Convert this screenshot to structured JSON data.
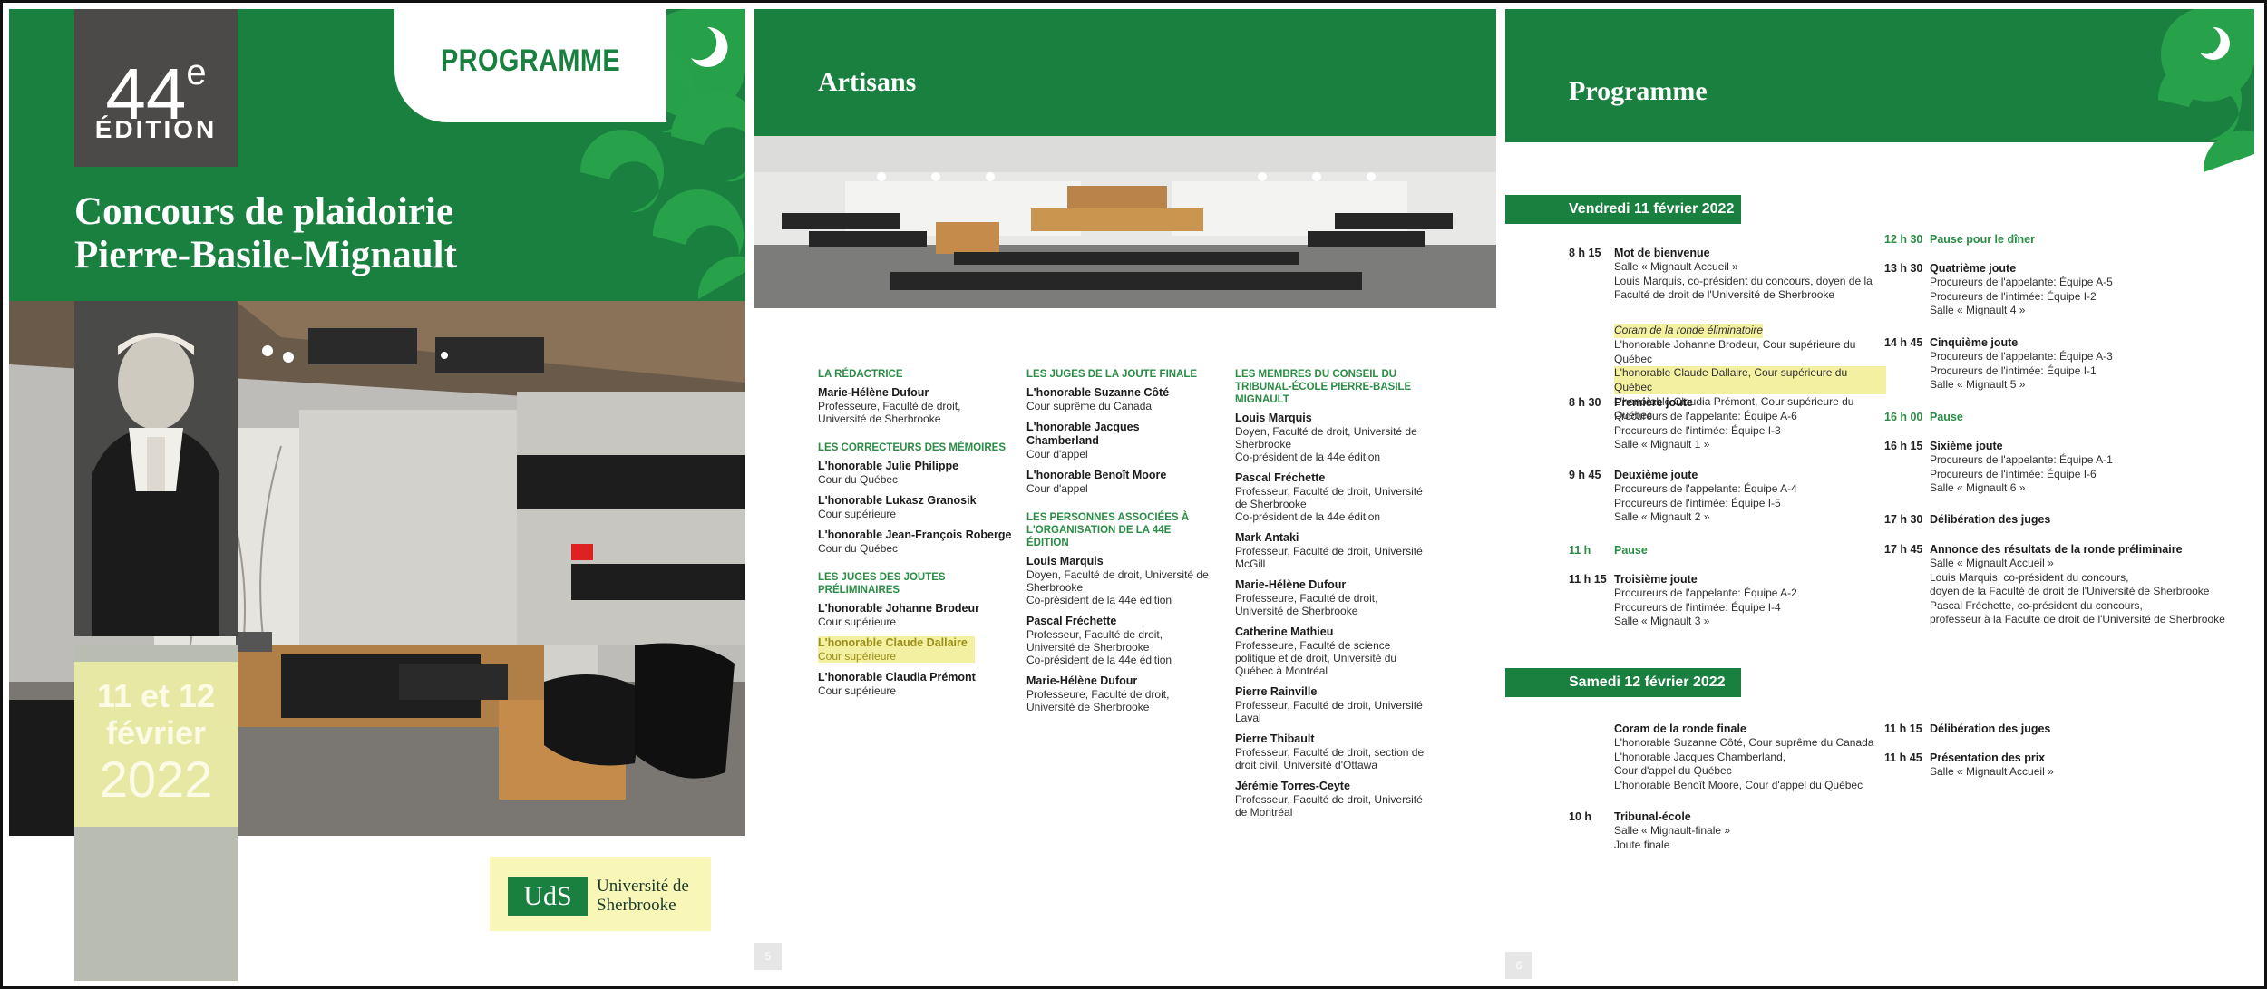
{
  "page1": {
    "edition_number": "44",
    "edition_suffix": "e",
    "edition_word": "ÉDITION",
    "tab_label": "PROGRAMME",
    "title_line1": "Concours de plaidoirie",
    "title_line2": "Pierre-Basile-Mignault",
    "date_line1": "11 et 12",
    "date_line2": "février",
    "date_line3": "2022",
    "logo_mark": "UdS",
    "logo_name_line1": "Université de",
    "logo_name_line2": "Sherbrooke",
    "colors": {
      "brand_green": "#1a8040",
      "highlight": "#f4f0a2"
    }
  },
  "page2": {
    "title": "Artisans",
    "page_number": "5",
    "col1": [
      {
        "heading": "LA RÉDACTRICE",
        "entries": [
          {
            "name": "Marie-Hélène Dufour",
            "roles": [
              "Professeure, Faculté de droit,",
              "Université de Sherbrooke"
            ]
          }
        ]
      },
      {
        "heading": "LES CORRECTEURS DES MÉMOIRES",
        "entries": [
          {
            "name": "L'honorable Julie Philippe",
            "roles": [
              "Cour du Québec"
            ]
          },
          {
            "name": "L'honorable Lukasz Granosik",
            "roles": [
              "Cour supérieure"
            ]
          },
          {
            "name": "L'honorable Jean-François Roberge",
            "roles": [
              "Cour du Québec"
            ]
          }
        ]
      },
      {
        "heading": "LES JUGES DES JOUTES PRÉLIMINAIRES",
        "entries": [
          {
            "name": "L'honorable Johanne Brodeur",
            "roles": [
              "Cour supérieure"
            ]
          },
          {
            "name": "L'honorable Claude Dallaire",
            "roles": [
              "Cour supérieure"
            ],
            "highlight": true
          },
          {
            "name": "L'honorable Claudia Prémont",
            "roles": [
              "Cour supérieure"
            ]
          }
        ]
      }
    ],
    "col2": [
      {
        "heading": "LES JUGES DE LA JOUTE FINALE",
        "entries": [
          {
            "name": "L'honorable Suzanne Côté",
            "roles": [
              "Cour suprême du Canada"
            ]
          },
          {
            "name": "L'honorable Jacques Chamberland",
            "roles": [
              "Cour d'appel"
            ]
          },
          {
            "name": "L'honorable Benoît Moore",
            "roles": [
              "Cour d'appel"
            ]
          }
        ]
      },
      {
        "heading": "LES PERSONNES ASSOCIÉES À L'ORGANISATION DE LA 44e ÉDITION",
        "entries": [
          {
            "name": "Louis Marquis",
            "roles": [
              "Doyen, Faculté de droit, Université de Sherbrooke",
              "Co-président de la 44e édition"
            ]
          },
          {
            "name": "Pascal Fréchette",
            "roles": [
              "Professeur, Faculté de droit, Université de Sherbrooke",
              "Co-président de la 44e édition"
            ]
          },
          {
            "name": "Marie-Hélène Dufour",
            "roles": [
              "Professeure, Faculté de droit, Université de Sherbrooke"
            ]
          }
        ]
      }
    ],
    "col3": [
      {
        "heading": "LES MEMBRES DU CONSEIL DU TRIBUNAL-ÉCOLE PIERRE-BASILE MIGNAULT",
        "entries": [
          {
            "name": "Louis Marquis",
            "roles": [
              "Doyen, Faculté de droit, Université de Sherbrooke",
              "Co-président de la 44e édition"
            ]
          },
          {
            "name": "Pascal Fréchette",
            "roles": [
              "Professeur, Faculté de droit, Université de Sherbrooke",
              "Co-président de la 44e édition"
            ]
          },
          {
            "name": "Mark Antaki",
            "roles": [
              "Professeur, Faculté de droit, Université McGill"
            ]
          },
          {
            "name": "Marie-Hélène Dufour",
            "roles": [
              "Professeure, Faculté de droit, Université de Sherbrooke"
            ]
          },
          {
            "name": "Catherine Mathieu",
            "roles": [
              "Professeure, Faculté de science politique et de droit, Université du Québec à Montréal"
            ]
          },
          {
            "name": "Pierre Rainville",
            "roles": [
              "Professeur, Faculté de droit, Université Laval"
            ]
          },
          {
            "name": "Pierre Thibault",
            "roles": [
              "Professeur, Faculté de droit, section de droit civil, Université d'Ottawa"
            ]
          },
          {
            "name": "Jérémie Torres-Ceyte",
            "roles": [
              "Professeur, Faculté de droit, Université de Montréal"
            ]
          }
        ]
      }
    ]
  },
  "page3": {
    "title": "Programme",
    "page_number": "6",
    "day1": "Vendredi 11 février 2022",
    "day2": "Samedi 12 février 2022",
    "day1_left": [
      {
        "time": "8 h 15",
        "title": "Mot de bienvenue",
        "lines": [
          "Salle « Mignault Accueil »",
          "Louis Marquis, co-président du concours, doyen de la",
          "Faculté de droit de l'Université de Sherbrooke"
        ]
      },
      {
        "time": "",
        "title": "",
        "lines": [
          "Coram de la ronde éliminatoire",
          "L'honorable Johanne Brodeur, Cour supérieure du Québec",
          "L'honorable Claude Dallaire, Cour supérieure du Québec",
          "L'honorable Claudia Prémont, Cour supérieure du Québec"
        ]
      },
      {
        "time": "8 h 30",
        "title": "Première joute",
        "lines": [
          "Procureurs de l'appelante: Équipe A-6",
          "Procureurs de l'intimée: Équipe I-3",
          "Salle « Mignault 1 »"
        ]
      },
      {
        "time": "9 h 45",
        "title": "Deuxième joute",
        "lines": [
          "Procureurs de l'appelante: Équipe A-4",
          "Procureurs de l'intimée: Équipe I-5",
          "Salle « Mignault 2 »"
        ]
      },
      {
        "time": "11 h",
        "title": "Pause",
        "lines": []
      },
      {
        "time": "11 h 15",
        "title": "Troisième joute",
        "lines": [
          "Procureurs de l'appelante: Équipe A-2",
          "Procureurs de l'intimée: Équipe I-4",
          "Salle « Mignault 3 »"
        ]
      }
    ],
    "day1_right": [
      {
        "time": "12 h 30",
        "title": "Pause pour le dîner",
        "lines": []
      },
      {
        "time": "13 h 30",
        "title": "Quatrième joute",
        "lines": [
          "Procureurs de l'appelante: Équipe A-5",
          "Procureurs de l'intimée: Équipe I-2",
          "Salle « Mignault 4 »"
        ]
      },
      {
        "time": "14 h 45",
        "title": "Cinquième joute",
        "lines": [
          "Procureurs de l'appelante: Équipe A-3",
          "Procureurs de l'intimée: Équipe I-1",
          "Salle « Mignault 5 »"
        ]
      },
      {
        "time": "16 h 00",
        "title": "Pause",
        "lines": []
      },
      {
        "time": "16 h 15",
        "title": "Sixième joute",
        "lines": [
          "Procureurs de l'appelante: Équipe A-1",
          "Procureurs de l'intimée: Équipe I-6",
          "Salle « Mignault 6 »"
        ]
      },
      {
        "time": "17 h 30",
        "title": "Délibération des juges",
        "lines": []
      },
      {
        "time": "17 h 45",
        "title": "Annonce des résultats de la ronde préliminaire",
        "lines": [
          "Salle « Mignault Accueil »",
          "Louis Marquis, co-président du concours,",
          "doyen de la Faculté de droit de l'Université de Sherbrooke",
          "Pascal Fréchette, co-président du concours,",
          "professeur à la Faculté de droit de l'Université de Sherbrooke"
        ]
      }
    ],
    "day2_left": [
      {
        "time": "",
        "title": "Coram de la ronde finale",
        "lines": [
          "L'honorable Suzanne Côté, Cour suprême du Canada",
          "L'honorable Jacques Chamberland,",
          "Cour d'appel du Québec",
          "L'honorable Benoît Moore, Cour d'appel du Québec"
        ]
      },
      {
        "time": "10 h",
        "title": "Tribunal-école",
        "lines": [
          "Salle « Mignault-finale »",
          "Joute finale"
        ]
      }
    ],
    "day2_right": [
      {
        "time": "11 h 15",
        "title": "Délibération des juges",
        "lines": []
      },
      {
        "time": "11 h 45",
        "title": "Présentation des prix",
        "lines": [
          "Salle « Mignault Accueil »"
        ]
      }
    ]
  }
}
